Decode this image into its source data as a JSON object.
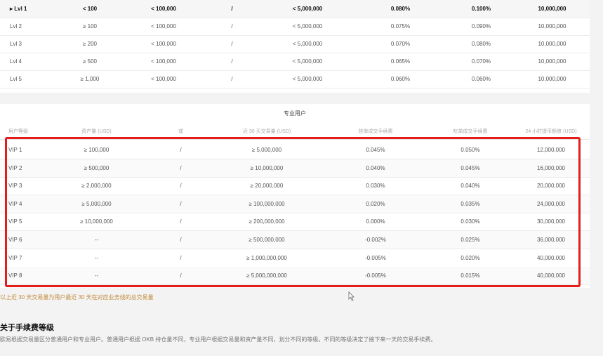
{
  "regular_table": {
    "rows": [
      {
        "level": "Lvl 1",
        "c1": "< 100",
        "c2": "< 100,000",
        "c3": "/",
        "c4": "< 5,000,000",
        "c5": "0.080%",
        "c6": "0.100%",
        "c7": "10,000,000",
        "selected": true
      },
      {
        "level": "Lvl 2",
        "c1": "≥ 100",
        "c2": "< 100,000",
        "c3": "/",
        "c4": "< 5,000,000",
        "c5": "0.075%",
        "c6": "0.090%",
        "c7": "10,000,000"
      },
      {
        "level": "Lvl 3",
        "c1": "≥ 200",
        "c2": "< 100,000",
        "c3": "/",
        "c4": "< 5,000,000",
        "c5": "0.070%",
        "c6": "0.080%",
        "c7": "10,000,000"
      },
      {
        "level": "Lvl 4",
        "c1": "≥ 500",
        "c2": "< 100,000",
        "c3": "/",
        "c4": "< 5,000,000",
        "c5": "0.065%",
        "c6": "0.070%",
        "c7": "10,000,000"
      },
      {
        "level": "Lvl 5",
        "c1": "≥ 1,000",
        "c2": "< 100,000",
        "c3": "/",
        "c4": "< 5,000,000",
        "c5": "0.060%",
        "c6": "0.060%",
        "c7": "10,000,000"
      }
    ]
  },
  "pro_table": {
    "title": "专业用户",
    "headers": [
      "用户等级",
      "资产量 (USD)",
      "或",
      "近 30 天交易量 (USD)",
      "挂单成交手续费",
      "吃单成交手续费",
      "24 小时提币额度 (USD)"
    ],
    "rows": [
      {
        "level": "VIP 1",
        "assets": "≥ 100,000",
        "or": "/",
        "volume": "≥ 5,000,000",
        "maker": "0.045%",
        "taker": "0.050%",
        "limit": "12,000,000"
      },
      {
        "level": "VIP 2",
        "assets": "≥ 500,000",
        "or": "/",
        "volume": "≥ 10,000,000",
        "maker": "0.040%",
        "taker": "0.045%",
        "limit": "16,000,000"
      },
      {
        "level": "VIP 3",
        "assets": "≥ 2,000,000",
        "or": "/",
        "volume": "≥ 20,000,000",
        "maker": "0.030%",
        "taker": "0.040%",
        "limit": "20,000,000"
      },
      {
        "level": "VIP 4",
        "assets": "≥ 5,000,000",
        "or": "/",
        "volume": "≥ 100,000,000",
        "maker": "0.020%",
        "taker": "0.035%",
        "limit": "24,000,000"
      },
      {
        "level": "VIP 5",
        "assets": "≥ 10,000,000",
        "or": "/",
        "volume": "≥ 200,000,000",
        "maker": "0.000%",
        "taker": "0.030%",
        "limit": "30,000,000"
      },
      {
        "level": "VIP 6",
        "assets": "--",
        "or": "/",
        "volume": "≥ 500,000,000",
        "maker": "-0.002%",
        "taker": "0.025%",
        "limit": "36,000,000"
      },
      {
        "level": "VIP 7",
        "assets": "--",
        "or": "/",
        "volume": "≥ 1,000,000,000",
        "maker": "-0.005%",
        "taker": "0.020%",
        "limit": "40,000,000"
      },
      {
        "level": "VIP 8",
        "assets": "--",
        "or": "/",
        "volume": "≥ 5,000,000,000",
        "maker": "-0.005%",
        "taker": "0.015%",
        "limit": "40,000,000"
      }
    ]
  },
  "footnote": "以上近 30 天交易量为用户最近 30 天在对应业务线的总交易量",
  "fee_section": {
    "title": "关于手续费等级",
    "description": "欧易根据交易量区分普通用户和专业用户。普通用户根据 OKB 持仓量不同，专业用户根据交易量和资产量不同，划分不同的等级。不同的等级决定了接下来一天的交易手续费。"
  },
  "colors": {
    "highlight": "#e41c1c",
    "footnote": "#c08a3a"
  }
}
